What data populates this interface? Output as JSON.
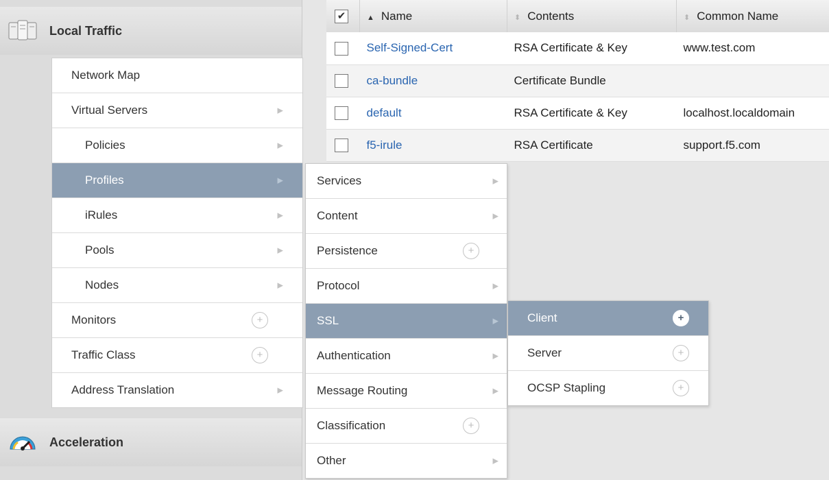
{
  "sidebar": {
    "section": "Local Traffic",
    "section2": "Acceleration",
    "items": [
      {
        "label": "Network Map",
        "sub": false,
        "suffix": "none"
      },
      {
        "label": "Virtual Servers",
        "sub": false,
        "suffix": "chevron"
      },
      {
        "label": "Policies",
        "sub": true,
        "suffix": "chevron"
      },
      {
        "label": "Profiles",
        "sub": true,
        "suffix": "chevron",
        "active": true
      },
      {
        "label": "iRules",
        "sub": true,
        "suffix": "chevron"
      },
      {
        "label": "Pools",
        "sub": true,
        "suffix": "chevron"
      },
      {
        "label": "Nodes",
        "sub": true,
        "suffix": "chevron"
      },
      {
        "label": "Monitors",
        "sub": false,
        "suffix": "plus"
      },
      {
        "label": "Traffic Class",
        "sub": false,
        "suffix": "plus"
      },
      {
        "label": "Address Translation",
        "sub": false,
        "suffix": "chevron"
      }
    ]
  },
  "profiles_menu": [
    {
      "label": "Services",
      "suffix": "chevron"
    },
    {
      "label": "Content",
      "suffix": "chevron"
    },
    {
      "label": "Persistence",
      "suffix": "plus"
    },
    {
      "label": "Protocol",
      "suffix": "chevron"
    },
    {
      "label": "SSL",
      "suffix": "chevron",
      "active": true
    },
    {
      "label": "Authentication",
      "suffix": "chevron"
    },
    {
      "label": "Message Routing",
      "suffix": "chevron"
    },
    {
      "label": "Classification",
      "suffix": "plus"
    },
    {
      "label": "Other",
      "suffix": "chevron"
    }
  ],
  "ssl_menu": [
    {
      "label": "Client",
      "suffix": "plus",
      "active": true
    },
    {
      "label": "Server",
      "suffix": "plus"
    },
    {
      "label": "OCSP Stapling",
      "suffix": "plus"
    }
  ],
  "table": {
    "headers": {
      "name": "Name",
      "contents": "Contents",
      "common_name": "Common Name"
    },
    "rows": [
      {
        "name": "Self-Signed-Cert",
        "contents": "RSA Certificate & Key",
        "common_name": "www.test.com"
      },
      {
        "name": "ca-bundle",
        "contents": "Certificate Bundle",
        "common_name": ""
      },
      {
        "name": "default",
        "contents": "RSA Certificate & Key",
        "common_name": "localhost.localdomain"
      },
      {
        "name": "f5-irule",
        "contents": "RSA Certificate",
        "common_name": "support.f5.com"
      }
    ]
  },
  "colors": {
    "active": "#8c9eb2",
    "link": "#2a65b0"
  }
}
